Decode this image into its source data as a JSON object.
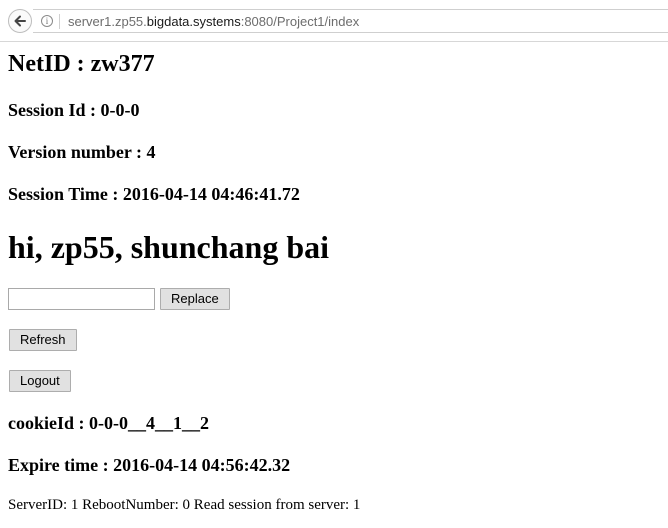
{
  "browser": {
    "url_prefix": "server1.zp55.",
    "url_host": "bigdata.systems",
    "url_suffix": ":8080/Project1/index"
  },
  "page": {
    "netid": "NetID : zw377",
    "session_id": "Session Id : 0-0-0",
    "version_number": "Version number : 4",
    "session_time": "Session Time : 2016-04-14 04:46:41.72",
    "greeting": "hi, zp55, shunchang bai",
    "replace_input_value": "",
    "replace_label": "Replace",
    "refresh_label": "Refresh",
    "logout_label": "Logout",
    "cookie_id": "cookieId : 0-0-0__4__1__2",
    "expire_time": "Expire time : 2016-04-14 04:56:42.32",
    "server_info": "ServerID: 1 RebootNumber: 0 Read session from server: 1"
  }
}
